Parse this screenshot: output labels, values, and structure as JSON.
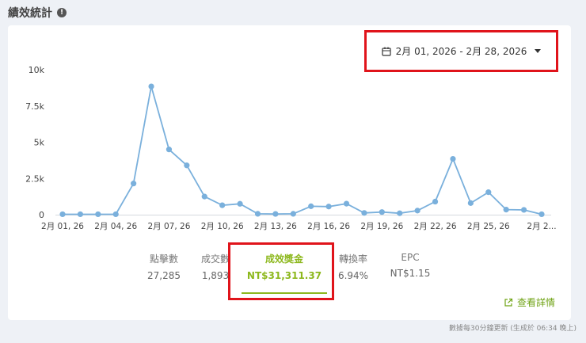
{
  "page": {
    "title": "績效統計",
    "info_icon": "!"
  },
  "date_range": {
    "label": "2月 01, 2026 - 2月 28, 2026"
  },
  "metrics": [
    {
      "label": "點擊數",
      "value": "27,285"
    },
    {
      "label": "成交數",
      "value": "1,893"
    },
    {
      "label": "成效獎金",
      "value": "NT$31,311.37",
      "active": true
    },
    {
      "label": "轉換率",
      "value": "6.94%"
    },
    {
      "label": "EPC",
      "value": "NT$1.15"
    }
  ],
  "details_link": "查看詳情",
  "footer_note": "數據每30分鐘更新 (生成於 06:34 晚上)",
  "colors": {
    "line": "#7ab0dc",
    "accent": "#8db81d",
    "highlight": "#e0141b"
  },
  "chart_data": {
    "type": "line",
    "x": [
      "2月 01, 26",
      "2月 02, 26",
      "2月 03, 26",
      "2月 04, 26",
      "2月 05, 26",
      "2月 06, 26",
      "2月 07, 26",
      "2月 08, 26",
      "2月 09, 26",
      "2月 10, 26",
      "2月 11, 26",
      "2月 12, 26",
      "2月 13, 26",
      "2月 14, 26",
      "2月 15, 26",
      "2月 16, 26",
      "2月 17, 26",
      "2月 18, 26",
      "2月 19, 26",
      "2月 20, 26",
      "2月 21, 26",
      "2月 22, 26",
      "2月 23, 26",
      "2月 24, 26",
      "2月 25, 26",
      "2月 26, 26",
      "2月 27, 26",
      "2月 28, 26"
    ],
    "values": [
      30,
      30,
      30,
      30,
      2150,
      8850,
      4500,
      3400,
      1250,
      650,
      750,
      60,
      50,
      60,
      580,
      560,
      760,
      120,
      180,
      100,
      280,
      900,
      3850,
      800,
      1550,
      350,
      330,
      30
    ],
    "tick_labels": [
      "2月 01, 26",
      "2月 04, 26",
      "2月 07, 26",
      "2月 10, 26",
      "2月 13, 26",
      "2月 16, 26",
      "2月 19, 26",
      "2月 22, 26",
      "2月 25, 26",
      "2月 2..."
    ],
    "tick_index": [
      0,
      3,
      6,
      9,
      12,
      15,
      18,
      21,
      24,
      27
    ],
    "y_ticks": [
      "0",
      "2.5k",
      "5k",
      "7.5k",
      "10k"
    ],
    "y_tick_values": [
      0,
      2500,
      5000,
      7500,
      10000
    ],
    "ylim": [
      0,
      10000
    ],
    "grid": false
  }
}
